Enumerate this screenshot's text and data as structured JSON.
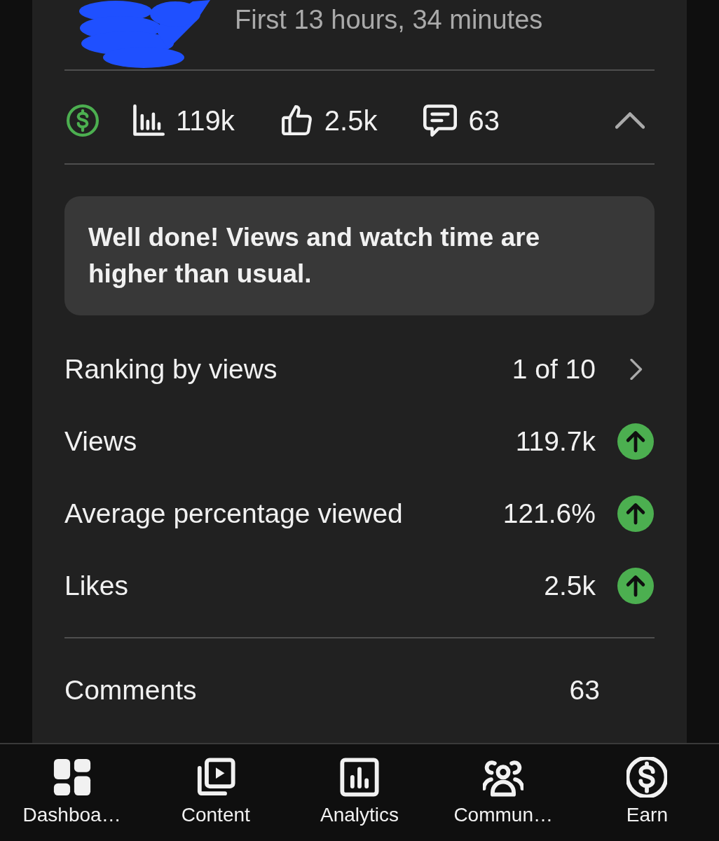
{
  "header": {
    "subtitle": "First 13 hours, 34 minutes"
  },
  "stats": {
    "monetized": true,
    "views": "119k",
    "likes": "2.5k",
    "comments": "63",
    "expanded": true
  },
  "message": "Well done! Views and watch time are higher than usual.",
  "metrics": [
    {
      "kind": "link",
      "label": "Ranking by views",
      "value": "1 of 10"
    },
    {
      "kind": "trend",
      "label": "Views",
      "value": "119.7k",
      "rising": true
    },
    {
      "kind": "trend",
      "label": "Average percentage viewed",
      "value": "121.6%",
      "rising": true
    },
    {
      "kind": "trend",
      "label": "Likes",
      "value": "2.5k",
      "rising": true
    }
  ],
  "comments": {
    "label": "Comments",
    "value": "63"
  },
  "nav": [
    {
      "label": "Dashboa…",
      "selected": true
    },
    {
      "label": "Content",
      "selected": false
    },
    {
      "label": "Analytics",
      "selected": false
    },
    {
      "label": "Commun…",
      "selected": false
    },
    {
      "label": "Earn",
      "selected": false
    }
  ]
}
